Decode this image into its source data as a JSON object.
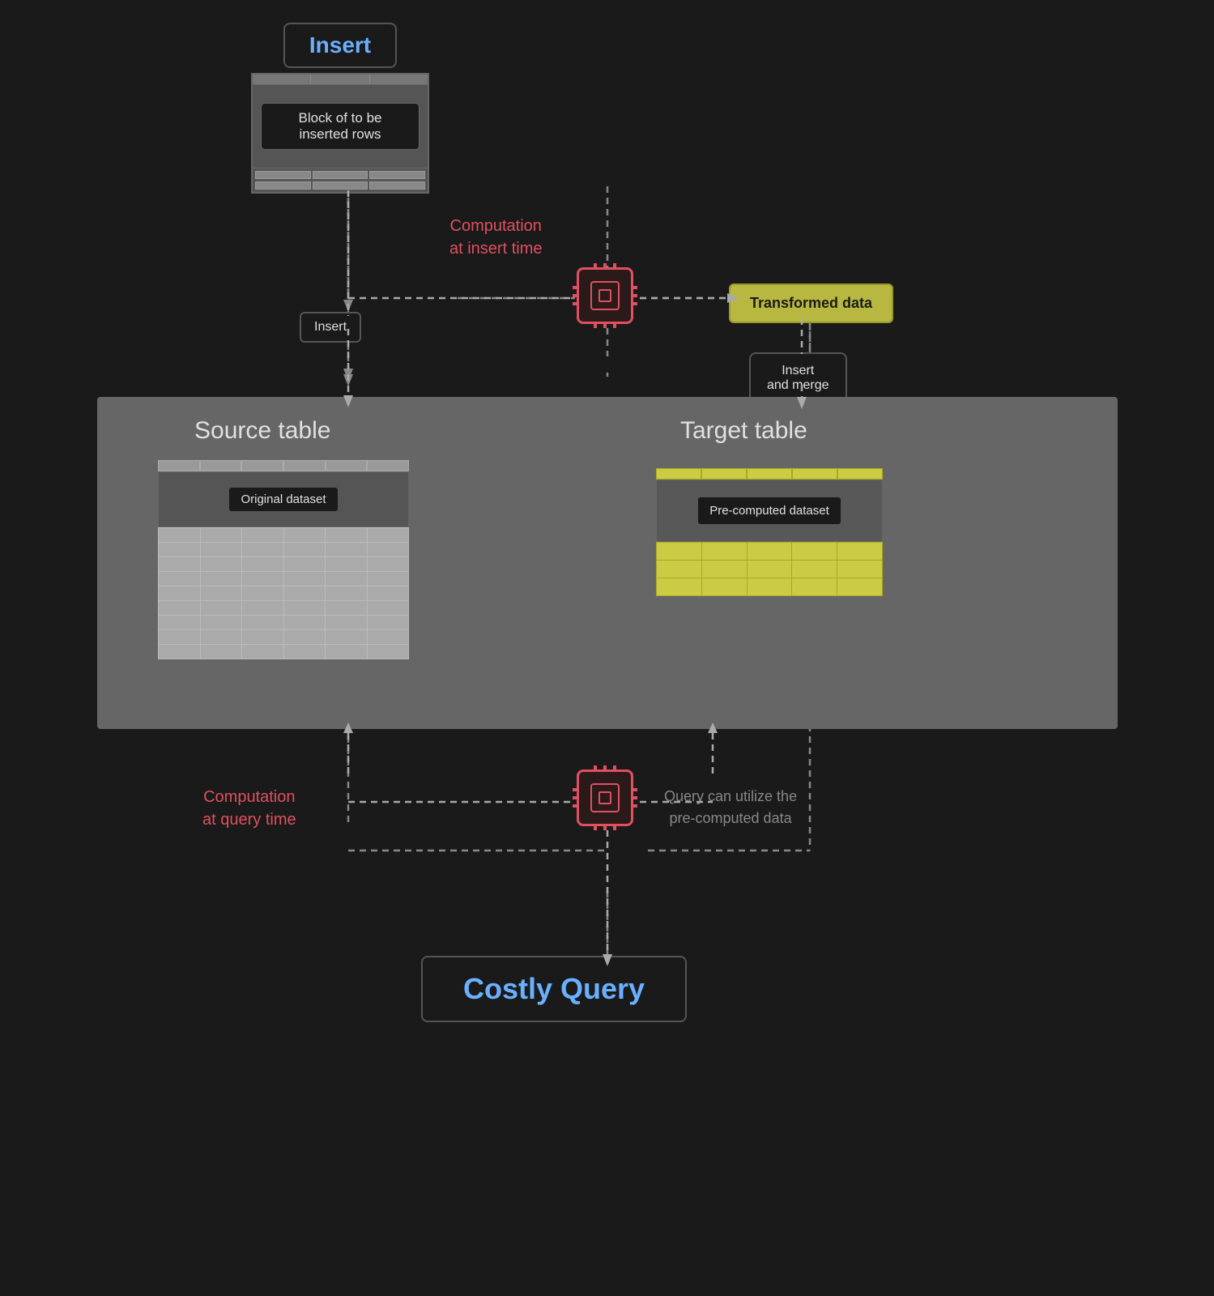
{
  "insert_top": {
    "label": "Insert",
    "block_rows_text": "Block of to be inserted rows"
  },
  "computation_insert": {
    "label": "Computation\nat insert time"
  },
  "transformed_data": {
    "label": "Transformed data"
  },
  "insert_merge": {
    "label": "Insert\nand merge"
  },
  "insert_small": {
    "label": "Insert"
  },
  "source_table": {
    "label": "Source table",
    "dataset_label": "Original dataset"
  },
  "target_table": {
    "label": "Target table",
    "dataset_label": "Pre-computed\ndataset"
  },
  "computation_query": {
    "label": "Computation\nat query time"
  },
  "query_utilization": {
    "label": "Query can utilize the\npre-computed data"
  },
  "costly_query": {
    "label": "Costly Query"
  },
  "colors": {
    "background": "#1a1a1a",
    "accent_blue": "#6ab0ff",
    "accent_red": "#e05060",
    "yellow": "#cccc44",
    "gray_text": "#888888"
  }
}
